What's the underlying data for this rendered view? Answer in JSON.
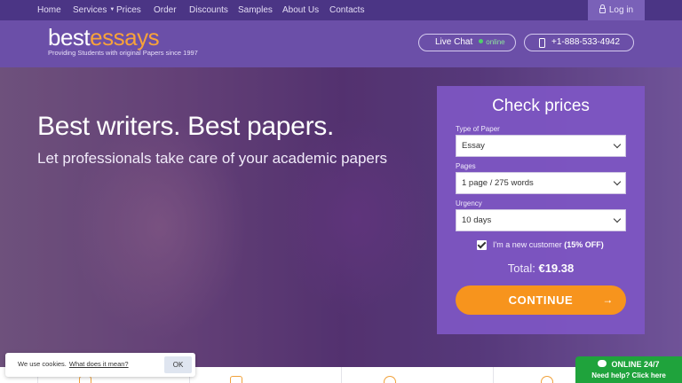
{
  "nav": {
    "items": [
      "Home",
      "Services",
      "Prices",
      "Order",
      "Discounts",
      "Samples",
      "About Us",
      "Contacts"
    ],
    "login_label": "Log in"
  },
  "header": {
    "logo_part1": "best",
    "logo_part2": "essays",
    "tagline": "Providing Students with original Papers since 1997",
    "live_chat_label": "Live Chat",
    "online_label": "online",
    "phone": "+1-888-533-4942"
  },
  "hero": {
    "headline": "Best writers. Best papers.",
    "subline": "Let professionals take care of your academic papers"
  },
  "form": {
    "title": "Check prices",
    "type_label": "Type of Paper",
    "type_value": "Essay",
    "pages_label": "Pages",
    "pages_value": "1 page / 275 words",
    "urgency_label": "Urgency",
    "urgency_value": "10 days",
    "new_customer_label": "I'm a new customer",
    "discount_label": "(15% OFF)",
    "total_label": "Total:",
    "total_value": "€19.38",
    "continue_label": "CONTINUE",
    "continue_arrow": "→"
  },
  "cookie": {
    "text": "We use cookies.",
    "link": "What does it mean?",
    "ok_label": "OK"
  },
  "online_badge": {
    "title": "ONLINE 24/7",
    "subtitle": "Need help? Click here"
  },
  "colors": {
    "nav_bg": "#4b3585",
    "header_bg": "#6b4fa8",
    "form_bg": "#7e56c4",
    "accent_orange": "#f7941d",
    "online_green": "#1fa33c"
  }
}
